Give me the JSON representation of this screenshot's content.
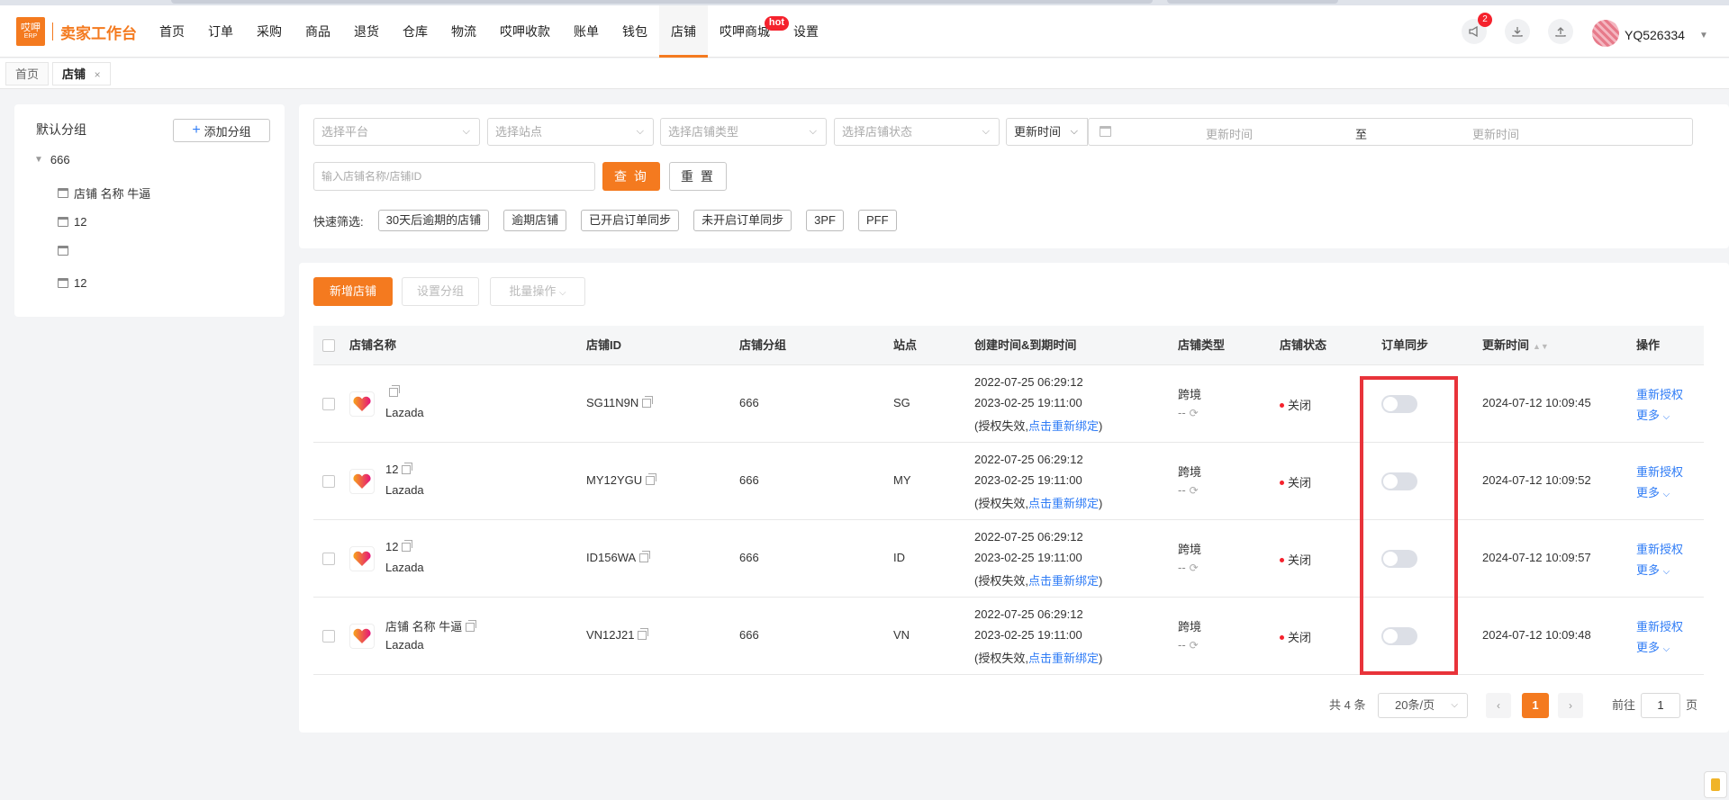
{
  "app": {
    "logo_top": "哎呷",
    "logo_erp": "ERP",
    "logo_title": "卖家工作台",
    "user_name": "YQ526334",
    "notification_count": "2",
    "accent_color": "#f47a1f"
  },
  "nav": {
    "items": [
      {
        "label": "首页"
      },
      {
        "label": "订单"
      },
      {
        "label": "采购"
      },
      {
        "label": "商品"
      },
      {
        "label": "退货"
      },
      {
        "label": "仓库"
      },
      {
        "label": "物流"
      },
      {
        "label": "哎呷收款"
      },
      {
        "label": "账单"
      },
      {
        "label": "钱包"
      },
      {
        "label": "店铺",
        "active": true
      },
      {
        "label": "哎呷商城",
        "badge": "hot"
      },
      {
        "label": "设置"
      }
    ],
    "header_icons": [
      "megaphone-icon",
      "download-icon",
      "upload-icon"
    ]
  },
  "tabs": [
    {
      "label": "首页"
    },
    {
      "label": "店铺",
      "active": true,
      "close": "×"
    }
  ],
  "groups": {
    "title": "默认分组",
    "add_label": "添加分组",
    "root": "666",
    "children": [
      "店铺 名称 牛逼",
      "12",
      "",
      "12"
    ]
  },
  "filters": {
    "platform_placeholder": "选择平台",
    "site_placeholder": "选择站点",
    "store_type_placeholder": "选择店铺类型",
    "store_status_placeholder": "选择店铺状态",
    "time_field": "更新时间",
    "date_start_placeholder": "更新时间",
    "date_to": "至",
    "date_end_placeholder": "更新时间",
    "search_placeholder": "输入店铺名称/店铺ID",
    "query_label": "查 询",
    "reset_label": "重 置",
    "quick_label": "快速筛选:",
    "quick_chips": [
      "30天后逾期的店铺",
      "逾期店铺",
      "已开启订单同步",
      "未开启订单同步",
      "3PF",
      "PFF"
    ]
  },
  "toolbar": {
    "new_store": "新增店铺",
    "set_group": "设置分组",
    "batch_ops": "批量操作"
  },
  "table": {
    "columns": [
      "店铺名称",
      "店铺ID",
      "店铺分组",
      "站点",
      "创建时间&到期时间",
      "店铺类型",
      "店铺状态",
      "订单同步",
      "更新时间",
      "操作"
    ],
    "rows": [
      {
        "name": "",
        "platform": "Lazada",
        "id": "SG11N9N",
        "group": "666",
        "site": "SG",
        "created": "2022-07-25 06:29:12",
        "expires": "2023-02-25 19:11:00",
        "auth_prefix": "(授权失效,",
        "auth_link": "点击重新绑定",
        "auth_suffix": ")",
        "type": "跨境",
        "type_sub": "--",
        "status": "关闭",
        "sync": false,
        "updated": "2024-07-12 10:09:45",
        "action1": "重新授权",
        "action2": "更多"
      },
      {
        "name": "12",
        "platform": "Lazada",
        "id": "MY12YGU",
        "group": "666",
        "site": "MY",
        "created": "2022-07-25 06:29:12",
        "expires": "2023-02-25 19:11:00",
        "auth_prefix": "(授权失效,",
        "auth_link": "点击重新绑定",
        "auth_suffix": ")",
        "type": "跨境",
        "type_sub": "--",
        "status": "关闭",
        "sync": false,
        "updated": "2024-07-12 10:09:52",
        "action1": "重新授权",
        "action2": "更多"
      },
      {
        "name": "12",
        "platform": "Lazada",
        "id": "ID156WA",
        "group": "666",
        "site": "ID",
        "created": "2022-07-25 06:29:12",
        "expires": "2023-02-25 19:11:00",
        "auth_prefix": "(授权失效,",
        "auth_link": "点击重新绑定",
        "auth_suffix": ")",
        "type": "跨境",
        "type_sub": "--",
        "status": "关闭",
        "sync": false,
        "updated": "2024-07-12 10:09:57",
        "action1": "重新授权",
        "action2": "更多"
      },
      {
        "name": "店铺 名称 牛逼",
        "platform": "Lazada",
        "id": "VN12J21",
        "group": "666",
        "site": "VN",
        "created": "2022-07-25 06:29:12",
        "expires": "2023-02-25 19:11:00",
        "auth_prefix": "(授权失效,",
        "auth_link": "点击重新绑定",
        "auth_suffix": ")",
        "type": "跨境",
        "type_sub": "--",
        "status": "关闭",
        "sync": false,
        "updated": "2024-07-12 10:09:48",
        "action1": "重新授权",
        "action2": "更多"
      }
    ]
  },
  "pagination": {
    "total": "共 4 条",
    "page_size": "20条/页",
    "current": "1",
    "goto_prefix": "前往",
    "goto_value": "1",
    "goto_suffix": "页"
  }
}
